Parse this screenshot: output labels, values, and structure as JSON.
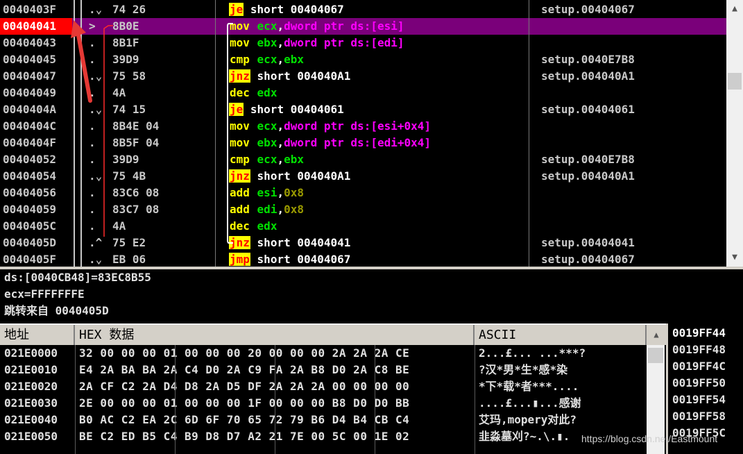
{
  "disasm": {
    "rows": [
      {
        "addr": "0040403F",
        "mark": ".⌄",
        "hex": "74 26",
        "mnemonic": "je",
        "mn_type": "jmp",
        "ops": [
          {
            "t": "short 00404067",
            "c": "tg"
          }
        ],
        "comment": "setup.00404067"
      },
      {
        "addr": "00404041",
        "mark": ">",
        "hex": "8B0E",
        "mnemonic": "mov",
        "mn_type": "plain",
        "ops": [
          {
            "t": "ecx",
            "c": "reg"
          },
          {
            "t": ",",
            "c": "comma"
          },
          {
            "t": "dword ptr ds:[esi]",
            "c": "kw"
          }
        ],
        "comment": "",
        "selected": true
      },
      {
        "addr": "00404043",
        "mark": ".",
        "hex": "8B1F",
        "mnemonic": "mov",
        "mn_type": "plain",
        "ops": [
          {
            "t": "ebx",
            "c": "reg"
          },
          {
            "t": ",",
            "c": "comma"
          },
          {
            "t": "dword ptr ds:[edi]",
            "c": "kw"
          }
        ],
        "comment": ""
      },
      {
        "addr": "00404045",
        "mark": ".",
        "hex": "39D9",
        "mnemonic": "cmp",
        "mn_type": "plain",
        "ops": [
          {
            "t": "ecx",
            "c": "reg"
          },
          {
            "t": ",",
            "c": "comma"
          },
          {
            "t": "ebx",
            "c": "reg"
          }
        ],
        "comment": "setup.0040E7B8"
      },
      {
        "addr": "00404047",
        "mark": ".⌄",
        "hex": "75 58",
        "mnemonic": "jnz",
        "mn_type": "jmp",
        "ops": [
          {
            "t": "short 004040A1",
            "c": "tg"
          }
        ],
        "comment": "setup.004040A1"
      },
      {
        "addr": "00404049",
        "mark": ".",
        "hex": "4A",
        "mnemonic": "dec",
        "mn_type": "plain",
        "ops": [
          {
            "t": "edx",
            "c": "reg"
          }
        ],
        "comment": ""
      },
      {
        "addr": "0040404A",
        "mark": ".⌄",
        "hex": "74 15",
        "mnemonic": "je",
        "mn_type": "jmp",
        "ops": [
          {
            "t": "short 00404061",
            "c": "tg"
          }
        ],
        "comment": "setup.00404061"
      },
      {
        "addr": "0040404C",
        "mark": ".",
        "hex": "8B4E 04",
        "mnemonic": "mov",
        "mn_type": "plain",
        "ops": [
          {
            "t": "ecx",
            "c": "reg"
          },
          {
            "t": ",",
            "c": "comma"
          },
          {
            "t": "dword ptr ds:[esi+0x4]",
            "c": "kw"
          }
        ],
        "comment": ""
      },
      {
        "addr": "0040404F",
        "mark": ".",
        "hex": "8B5F 04",
        "mnemonic": "mov",
        "mn_type": "plain",
        "ops": [
          {
            "t": "ebx",
            "c": "reg"
          },
          {
            "t": ",",
            "c": "comma"
          },
          {
            "t": "dword ptr ds:[edi+0x4]",
            "c": "kw"
          }
        ],
        "comment": ""
      },
      {
        "addr": "00404052",
        "mark": ".",
        "hex": "39D9",
        "mnemonic": "cmp",
        "mn_type": "plain",
        "ops": [
          {
            "t": "ecx",
            "c": "reg"
          },
          {
            "t": ",",
            "c": "comma"
          },
          {
            "t": "ebx",
            "c": "reg"
          }
        ],
        "comment": "setup.0040E7B8"
      },
      {
        "addr": "00404054",
        "mark": ".⌄",
        "hex": "75 4B",
        "mnemonic": "jnz",
        "mn_type": "jmp",
        "ops": [
          {
            "t": "short 004040A1",
            "c": "tg"
          }
        ],
        "comment": "setup.004040A1"
      },
      {
        "addr": "00404056",
        "mark": ".",
        "hex": "83C6 08",
        "mnemonic": "add",
        "mn_type": "plain",
        "ops": [
          {
            "t": "esi",
            "c": "reg"
          },
          {
            "t": ",",
            "c": "comma"
          },
          {
            "t": "0x8",
            "c": "num"
          }
        ],
        "comment": ""
      },
      {
        "addr": "00404059",
        "mark": ".",
        "hex": "83C7 08",
        "mnemonic": "add",
        "mn_type": "plain",
        "ops": [
          {
            "t": "edi",
            "c": "reg"
          },
          {
            "t": ",",
            "c": "comma"
          },
          {
            "t": "0x8",
            "c": "num"
          }
        ],
        "comment": ""
      },
      {
        "addr": "0040405C",
        "mark": ".",
        "hex": "4A",
        "mnemonic": "dec",
        "mn_type": "plain",
        "ops": [
          {
            "t": "edx",
            "c": "reg"
          }
        ],
        "comment": ""
      },
      {
        "addr": "0040405D",
        "mark": ".^",
        "hex": "75 E2",
        "mnemonic": "jnz",
        "mn_type": "jmp",
        "ops": [
          {
            "t": "short 00404041",
            "c": "tg"
          }
        ],
        "comment": "setup.00404041"
      },
      {
        "addr": "0040405F",
        "mark": ".⌄",
        "hex": "EB 06",
        "mnemonic": "jmp",
        "mn_type": "jmp",
        "ops": [
          {
            "t": "short 00404067",
            "c": "tg"
          }
        ],
        "comment": "setup.00404067"
      }
    ]
  },
  "info": {
    "lines": [
      "ds:[0040CB48]=83EC8B55",
      "ecx=FFFFFFFE",
      "跳转来自 0040405D"
    ]
  },
  "dump": {
    "headers": {
      "addr": "地址",
      "hex": "HEX 数据",
      "ascii": "ASCII"
    },
    "rows": [
      {
        "addr": "021E0000",
        "hex": "32 00 00 00 01 00 00 00 20 00 00 00 2A 2A 2A CE",
        "ascii": "2...£... ...***?"
      },
      {
        "addr": "021E0010",
        "hex": "E4 2A BA BA 2A C4 D0 2A C9 FA 2A B8 D0 2A C8 BE",
        "ascii": "?汉*男*生*感*染"
      },
      {
        "addr": "021E0020",
        "hex": "2A CF C2 2A D4 D8 2A D5 DF 2A 2A 2A 00 00 00 00",
        "ascii": "*下*载*者***...."
      },
      {
        "addr": "021E0030",
        "hex": "2E 00 00 00 01 00 00 00 1F 00 00 00 B8 D0 D0 BB",
        "ascii": "....£...▮...感谢"
      },
      {
        "addr": "021E0040",
        "hex": "B0 AC C2 EA 2C 6D 6F 70 65 72 79 B6 D4 B4 CB C4",
        "ascii": "艾玛,mopery对此?"
      },
      {
        "addr": "021E0050",
        "hex": "BE C2 ED B5 C4 B9 D8 D7 A2 21 7E 00 5C 00 1E 02",
        "ascii": "韭淼墓刈?~.\\.▮."
      }
    ]
  },
  "stack": {
    "rows": [
      "0019FF44",
      "0019FF48",
      "0019FF4C",
      "0019FF50",
      "0019FF54",
      "0019FF58",
      "0019FF5C"
    ]
  },
  "watermark": "https://blog.csdn.net/Eastmount",
  "colors": {
    "selection": "#7a007a",
    "addr_highlight": "#ff0000",
    "jump_mnemonic_bg": "#ffff00",
    "register": "#00e000",
    "memory_operand": "#ff00ff",
    "annotation_arrow": "#e53935"
  }
}
